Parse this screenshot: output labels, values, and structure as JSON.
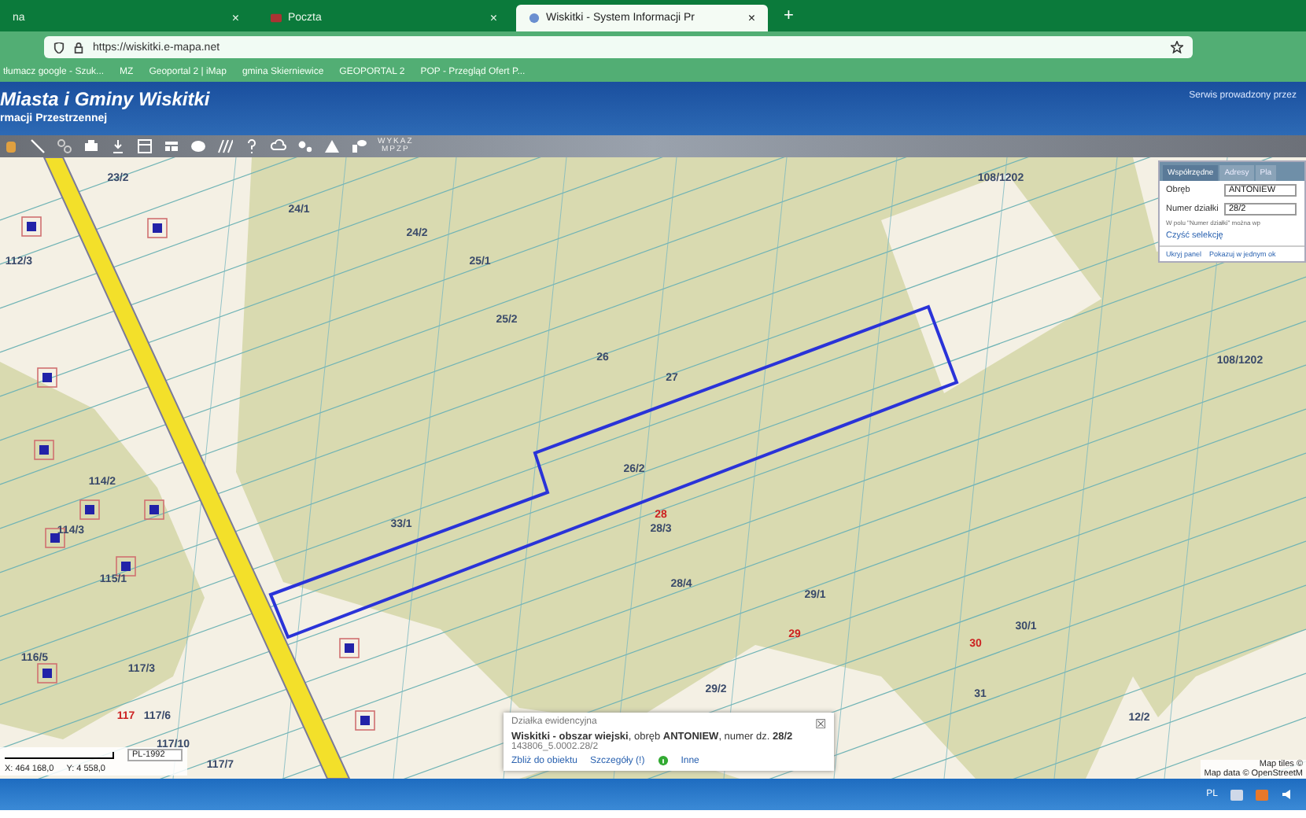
{
  "browser": {
    "tabs": [
      {
        "label": "na",
        "close": "×",
        "selected": false
      },
      {
        "label": "Poczta",
        "close": "×",
        "selected": false
      },
      {
        "label": "Wiskitki - System Informacji Pr",
        "close": "×",
        "selected": true
      }
    ],
    "new_tab": "+",
    "url": "https://wiskitki.e-mapa.net",
    "bookmarks": [
      "tłumacz google - Szuk...",
      "MZ",
      "Geoportal 2 | iMap",
      "gmina Skierniewice",
      "GEOPORTAL 2",
      "POP - Przegląd Ofert P..."
    ]
  },
  "header": {
    "title": "Miasta i Gminy Wiskitki",
    "subtitle": "rmacji Przestrzennej",
    "service": "Serwis prowadzony przez"
  },
  "toolbar": {
    "wykaz_line1": "WYKAZ",
    "wykaz_line2": "MPZP"
  },
  "search_panel": {
    "tabs": [
      {
        "label": "Współrzędne",
        "selected": true
      },
      {
        "label": "Adresy",
        "selected": false
      },
      {
        "label": "Pla",
        "selected": false
      }
    ],
    "fields": [
      {
        "label": "Obręb",
        "value": "ANTONIEW"
      },
      {
        "label": "Numer działki",
        "value": "28/2"
      }
    ],
    "hint": "W polu \"Numer działki\" można wp",
    "clear": "Czyść selekcję",
    "hide": "Ukryj panel",
    "single_window": "Pokazuj w jednym ok"
  },
  "map": {
    "parcel_labels": [
      {
        "text": "23/2",
        "color": "#3a4a6a"
      },
      {
        "text": "24/1",
        "color": "#3a4a6a"
      },
      {
        "text": "24/2",
        "color": "#3a4a6a"
      },
      {
        "text": "25/1",
        "color": "#3a4a6a"
      },
      {
        "text": "25/2",
        "color": "#3a4a6a"
      },
      {
        "text": "26",
        "color": "#3a4a6a"
      },
      {
        "text": "27",
        "color": "#3a4a6a"
      },
      {
        "text": "26/2",
        "color": "#3a4a6a"
      },
      {
        "text": "28",
        "color": "#cc2222"
      },
      {
        "text": "28/3",
        "color": "#3a4a6a"
      },
      {
        "text": "28/4",
        "color": "#3a4a6a"
      },
      {
        "text": "29/1",
        "color": "#3a4a6a"
      },
      {
        "text": "29",
        "color": "#cc2222"
      },
      {
        "text": "30",
        "color": "#cc2222"
      },
      {
        "text": "30/1",
        "color": "#3a4a6a"
      },
      {
        "text": "29/2",
        "color": "#3a4a6a"
      },
      {
        "text": "31",
        "color": "#3a4a6a"
      },
      {
        "text": "12/2",
        "color": "#3a4a6a"
      },
      {
        "text": "108/1202",
        "color": "#3a4a6a"
      },
      {
        "text": "108/1202",
        "color": "#3a4a6a"
      },
      {
        "text": "33/1",
        "color": "#3a4a6a"
      },
      {
        "text": "112/3",
        "color": "#3a4a6a"
      },
      {
        "text": "114/2",
        "color": "#3a4a6a"
      },
      {
        "text": "114/3",
        "color": "#3a4a6a"
      },
      {
        "text": "115/1",
        "color": "#3a4a6a"
      },
      {
        "text": "116/5",
        "color": "#3a4a6a"
      },
      {
        "text": "117/3",
        "color": "#3a4a6a"
      },
      {
        "text": "117",
        "color": "#cc2222"
      },
      {
        "text": "117/6",
        "color": "#3a4a6a"
      },
      {
        "text": "117/10",
        "color": "#3a4a6a"
      },
      {
        "text": "117/7",
        "color": "#3a4a6a"
      }
    ],
    "crs": "PL-1992",
    "coord_x": "X: 464 168,0",
    "coord_y": "Y: 4 558,0",
    "tiles_credit": "Map tiles ©",
    "data_credit": "Map data © OpenStreetM"
  },
  "popup": {
    "heading": "Działka ewidencyjna",
    "close": "☒",
    "description": "**Wiskitki - obszar wiejski**, obręb **ANTONIEW**, numer dz. **28/2**",
    "identifier": "143806_5.0002.28/2",
    "links": [
      "Zbliż do obiektu",
      "Szczegóły (!)",
      "Inne"
    ]
  },
  "taskbar": {
    "language": "PL"
  }
}
